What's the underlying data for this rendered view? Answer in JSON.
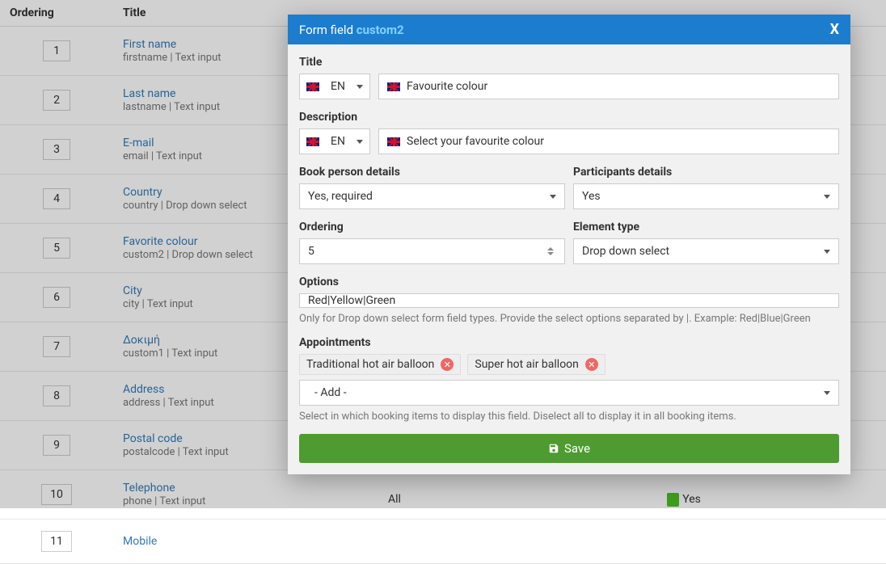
{
  "table": {
    "headers": {
      "ordering": "Ordering",
      "title": "Title"
    },
    "rows": [
      {
        "order": "1",
        "title": "First name",
        "meta": "firstname  |  Text input"
      },
      {
        "order": "2",
        "title": "Last name",
        "meta": "lastname  |  Text input"
      },
      {
        "order": "3",
        "title": "E-mail",
        "meta": "email  |  Text input"
      },
      {
        "order": "4",
        "title": "Country",
        "meta": "country  |  Drop down select"
      },
      {
        "order": "5",
        "title": "Favorite colour",
        "meta": "custom2  |  Drop down select"
      },
      {
        "order": "6",
        "title": "City",
        "meta": "city  |  Text input"
      },
      {
        "order": "7",
        "title": "Δοκιμή",
        "meta": "custom1  |  Text input"
      },
      {
        "order": "8",
        "title": "Address",
        "meta": "address  |  Text input"
      },
      {
        "order": "9",
        "title": "Postal code",
        "meta": "postalcode  |  Text input"
      },
      {
        "order": "10",
        "title": "Telephone",
        "meta": "phone  |  Text input"
      },
      {
        "order": "11",
        "title": "Mobile",
        "meta": ""
      }
    ]
  },
  "peek": {
    "all": "All",
    "yes": "Yes"
  },
  "modal": {
    "header_prefix": "Form field ",
    "header_name": "custom2",
    "close": "X",
    "labels": {
      "title": "Title",
      "description": "Description",
      "book_person": "Book person details",
      "participants": "Participants details",
      "ordering": "Ordering",
      "element_type": "Element type",
      "options": "Options",
      "appointments": "Appointments"
    },
    "lang": "EN",
    "title_value": "Favourite colour",
    "description_value": "Select your favourite colour",
    "book_person_value": "Yes, required",
    "participants_value": "Yes",
    "ordering_value": "5",
    "element_type_value": "Drop down select",
    "options_value": "Red|Yellow|Green",
    "options_help": "Only for Drop down select form field types. Provide the select options separated by |. Example: Red|Blue|Green",
    "chips": [
      "Traditional hot air balloon",
      "Super hot air balloon"
    ],
    "appointments_add": "- Add -",
    "appointments_help": "Select in which booking items to display this field. Diselect all to display it in all booking items.",
    "save": "Save"
  }
}
